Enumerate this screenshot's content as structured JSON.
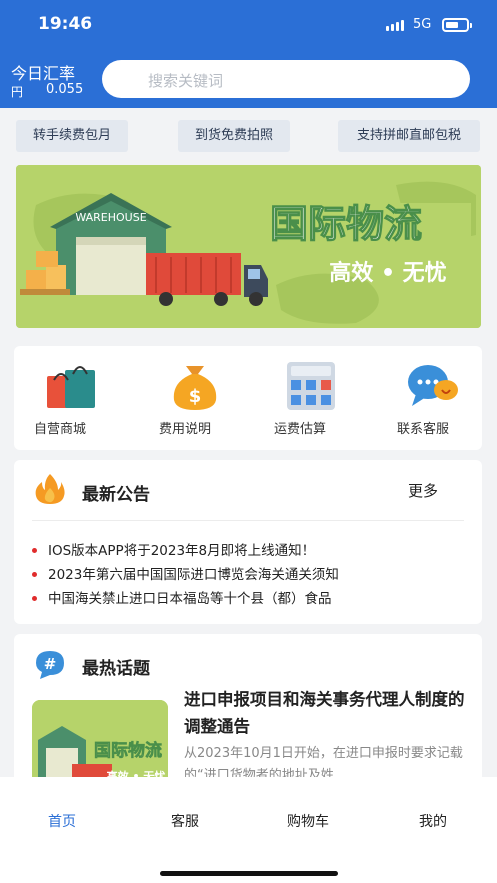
{
  "status_bar": {
    "time": "19:46",
    "network": "5G"
  },
  "header": {
    "rate_label": "今日汇率",
    "rate_unit": "円",
    "rate_value": "0.055",
    "search_placeholder": "搜索关键词"
  },
  "chips": [
    "转手续费包月",
    "到货免费拍照",
    "支持拼邮直邮包税"
  ],
  "banner": {
    "warehouse_text": "WAREHOUSE",
    "title": "国际物流",
    "subtitle": "高效 • 无忧"
  },
  "quick_links": [
    {
      "label": "自营商城",
      "icon": "shopping-bag-icon"
    },
    {
      "label": "费用说明",
      "icon": "money-bag-icon"
    },
    {
      "label": "运费估算",
      "icon": "calculator-icon"
    },
    {
      "label": "联系客服",
      "icon": "chat-bubble-icon"
    }
  ],
  "notice": {
    "title": "最新公告",
    "more": "更多",
    "items": [
      "IOS版本APP将于2023年8月即将上线通知！",
      "2023年第六届中国国际进口博览会海关通关须知",
      "中国海关禁止进口日本福岛等十个县（都）食品"
    ]
  },
  "topics": {
    "title": "最热话题",
    "icon_char": "#",
    "item": {
      "title": "进口申报项目和海关事务代理人制度的调整通告",
      "desc": "从2023年10月1日开始，在进口申报时要求记载的“进口货物者的地址及姓",
      "thumb_title": "国际物流",
      "thumb_subtitle": "高效 • 无忧"
    }
  },
  "tabbar": {
    "tabs": [
      "首页",
      "客服",
      "购物车",
      "我的"
    ],
    "active_index": 0
  },
  "colors": {
    "brand_blue": "#2b6fd6",
    "banner_green": "#b6d36a",
    "notice_red": "#e02c2c"
  }
}
